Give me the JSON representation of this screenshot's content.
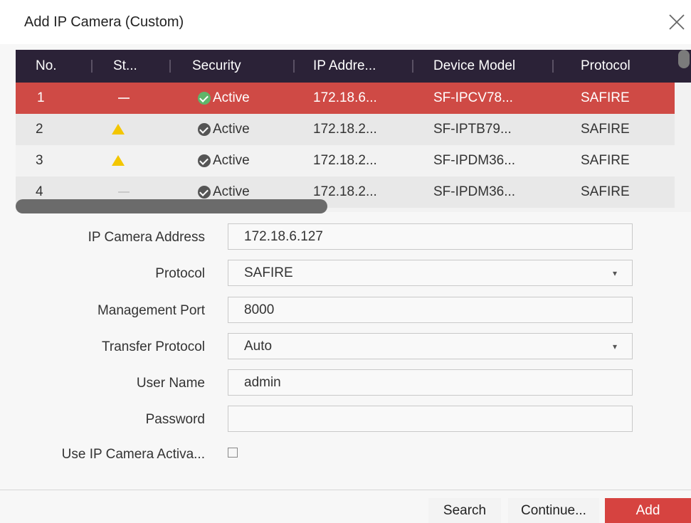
{
  "dialog": {
    "title": "Add IP Camera (Custom)"
  },
  "table": {
    "headers": [
      "No.",
      "St...",
      "Security",
      "IP Addre...",
      "Device Model",
      "Protocol"
    ],
    "rows": [
      {
        "no": "1",
        "status": "dash",
        "security": "Active",
        "ip": "172.18.6...",
        "model": "SF-IPCV78...",
        "protocol": "SAFIRE",
        "selected": true
      },
      {
        "no": "2",
        "status": "warning",
        "security": "Active",
        "ip": "172.18.2...",
        "model": "SF-IPTB79...",
        "protocol": "SAFIRE",
        "selected": false
      },
      {
        "no": "3",
        "status": "warning",
        "security": "Active",
        "ip": "172.18.2...",
        "model": "SF-IPDM36...",
        "protocol": "SAFIRE",
        "selected": false
      },
      {
        "no": "4",
        "status": "dash",
        "security": "Active",
        "ip": "172.18.2...",
        "model": "SF-IPDM36...",
        "protocol": "SAFIRE",
        "selected": false
      }
    ]
  },
  "form": {
    "ip_address_label": "IP Camera Address",
    "ip_address_value": "172.18.6.127",
    "protocol_label": "Protocol",
    "protocol_value": "SAFIRE",
    "management_port_label": "Management Port",
    "management_port_value": "8000",
    "transfer_protocol_label": "Transfer Protocol",
    "transfer_protocol_value": "Auto",
    "user_name_label": "User Name",
    "user_name_value": "admin",
    "password_label": "Password",
    "password_value": "",
    "activation_label": "Use IP Camera Activa..."
  },
  "buttons": {
    "search": "Search",
    "continue": "Continue...",
    "add": "Add"
  },
  "colors": {
    "header_bg": "#2b2237",
    "selected_row": "#cf4a45",
    "warning": "#f3c600",
    "add_button": "#d64340"
  }
}
